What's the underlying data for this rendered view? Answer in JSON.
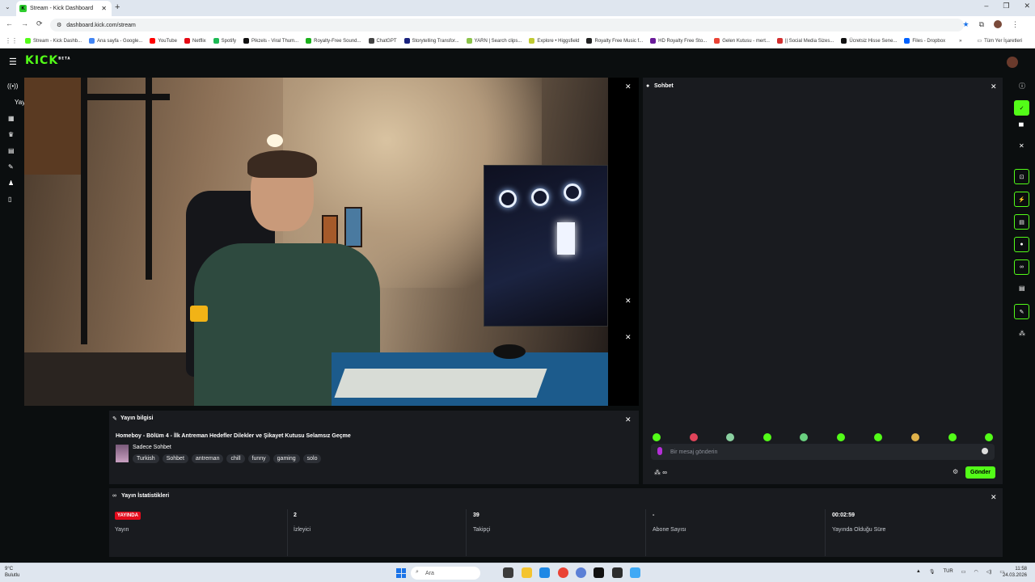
{
  "browser": {
    "tab_title": "Stream - Kick Dashboard",
    "url": "dashboard.kick.com/stream",
    "bookmarks": [
      {
        "label": "Stream - Kick Dashb...",
        "color": "#53fc18"
      },
      {
        "label": "Ana sayfa - Google...",
        "color": "#4285f4"
      },
      {
        "label": "YouTube",
        "color": "#ff0000"
      },
      {
        "label": "Netflix",
        "color": "#e50914"
      },
      {
        "label": "Spotify",
        "color": "#1db954"
      },
      {
        "label": "Pikzels - Viral Thum...",
        "color": "#111111"
      },
      {
        "label": "Royalty-Free Sound...",
        "color": "#1bb11b"
      },
      {
        "label": "ChatGPT",
        "color": "#444444"
      },
      {
        "label": "Storytelling Transfor...",
        "color": "#1a237e"
      },
      {
        "label": "YARN | Search clips...",
        "color": "#8bc34a"
      },
      {
        "label": "Explore • Higgsfield",
        "color": "#c0ca33"
      },
      {
        "label": "Royalty Free Music f...",
        "color": "#222222"
      },
      {
        "label": "HD Royalty Free Sto...",
        "color": "#6a1b9a"
      },
      {
        "label": "Gelen Kutusu - mert...",
        "color": "#ea4335"
      },
      {
        "label": "|| Social Media Sizes...",
        "color": "#d32f2f"
      },
      {
        "label": "Ücretsiz Hisse Sene...",
        "color": "#111111"
      },
      {
        "label": "Files - Dropbox",
        "color": "#0061ff"
      }
    ],
    "all_bookmarks": "Tüm Yer İşaretleri"
  },
  "kick": {
    "logo": "KICK",
    "logo_badge": "BETA",
    "left_nav_top": "Yayın"
  },
  "chat": {
    "title": "Sohbet",
    "placeholder": "Bir mesaj gönderin",
    "send_label": "Gönder",
    "emote_count": 10
  },
  "info": {
    "heading": "Yayın bilgisi",
    "stream_title": "Homeboy - Bölüm 4 - İlk Antreman Hedefler Dilekler ve Şikayet Kutusu Selamsız Geçme",
    "category": "Sadece Sohbet",
    "tags": [
      "Turkish",
      "Sohbet",
      "antreman",
      "chill",
      "funny",
      "gaming",
      "solo"
    ]
  },
  "stats": {
    "heading": "Yayın İstatistikleri",
    "items": [
      {
        "value": "YAYINDA",
        "label": "Yayın",
        "live": true
      },
      {
        "value": "2",
        "label": "İzleyici",
        "live": false
      },
      {
        "value": "39",
        "label": "Takipçi",
        "live": false
      },
      {
        "value": "-",
        "label": "Abone Sayısı",
        "live": false
      },
      {
        "value": "00:02:59",
        "label": "Yayında Olduğu Süre",
        "live": false
      }
    ]
  },
  "taskbar": {
    "temp": "9°C",
    "weather": "Bulutlu",
    "search": "Ara",
    "lang": "TUR",
    "time": "11:58",
    "date": "24.03.2026"
  },
  "colors": {
    "kick_green": "#53fc18",
    "live_red": "#e30b1c",
    "panel_bg": "#191b1f"
  }
}
